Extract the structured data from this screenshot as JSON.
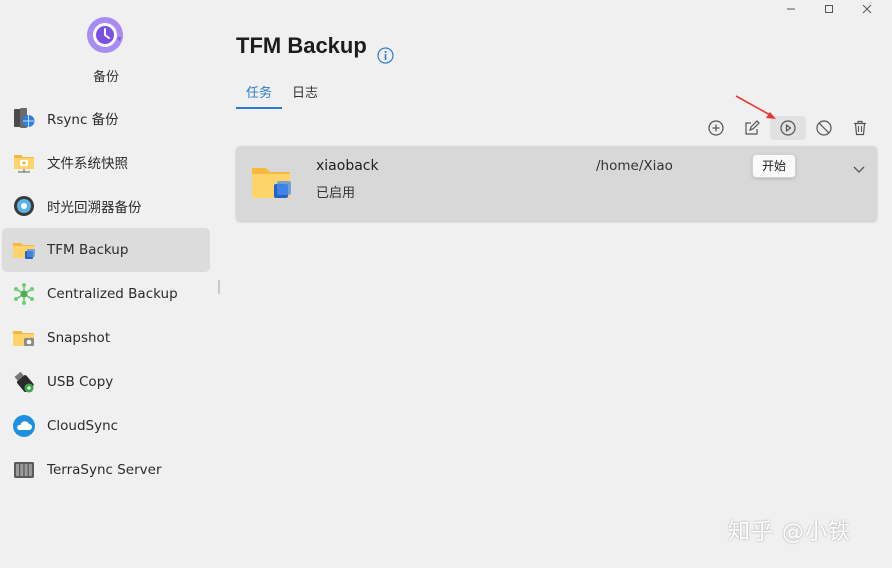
{
  "window": {
    "controls": [
      {
        "name": "minimize",
        "icon": "minimize-icon"
      },
      {
        "name": "maximize",
        "icon": "maximize-icon"
      },
      {
        "name": "close",
        "icon": "close-icon"
      }
    ]
  },
  "app": {
    "name": "备份",
    "logo_icon": "clock-backup-icon",
    "accent_color": "#2a7bd1"
  },
  "sidebar": {
    "items": [
      {
        "label": "Rsync 备份",
        "icon": "server-globe-icon"
      },
      {
        "label": "文件系统快照",
        "icon": "folder-snapshot-icon"
      },
      {
        "label": "时光回溯器备份",
        "icon": "time-machine-icon"
      },
      {
        "label": "TFM Backup",
        "icon": "folder-backup-icon",
        "active": true
      },
      {
        "label": "Centralized Backup",
        "icon": "network-nodes-icon"
      },
      {
        "label": "Snapshot",
        "icon": "folder-camera-icon"
      },
      {
        "label": "USB Copy",
        "icon": "usb-drive-icon"
      },
      {
        "label": "CloudSync",
        "icon": "cloud-sync-icon"
      },
      {
        "label": "TerraSync Server",
        "icon": "server-rack-icon"
      }
    ]
  },
  "main": {
    "title": "TFM Backup",
    "info_icon": "info-icon",
    "tabs": [
      {
        "label": "任务",
        "active": true
      },
      {
        "label": "日志",
        "active": false
      }
    ],
    "toolbar": [
      {
        "name": "add",
        "icon": "plus-circle-icon"
      },
      {
        "name": "edit",
        "icon": "edit-icon"
      },
      {
        "name": "start",
        "icon": "play-circle-icon",
        "hovered": true
      },
      {
        "name": "disable",
        "icon": "ban-icon"
      },
      {
        "name": "delete",
        "icon": "trash-icon"
      }
    ],
    "tooltip": "开始",
    "tasks": [
      {
        "name": "xiaoback",
        "status": "已启用",
        "path": "/home/Xiao",
        "icon": "folder-backup-icon"
      }
    ]
  },
  "watermark": "知乎 @小铁"
}
